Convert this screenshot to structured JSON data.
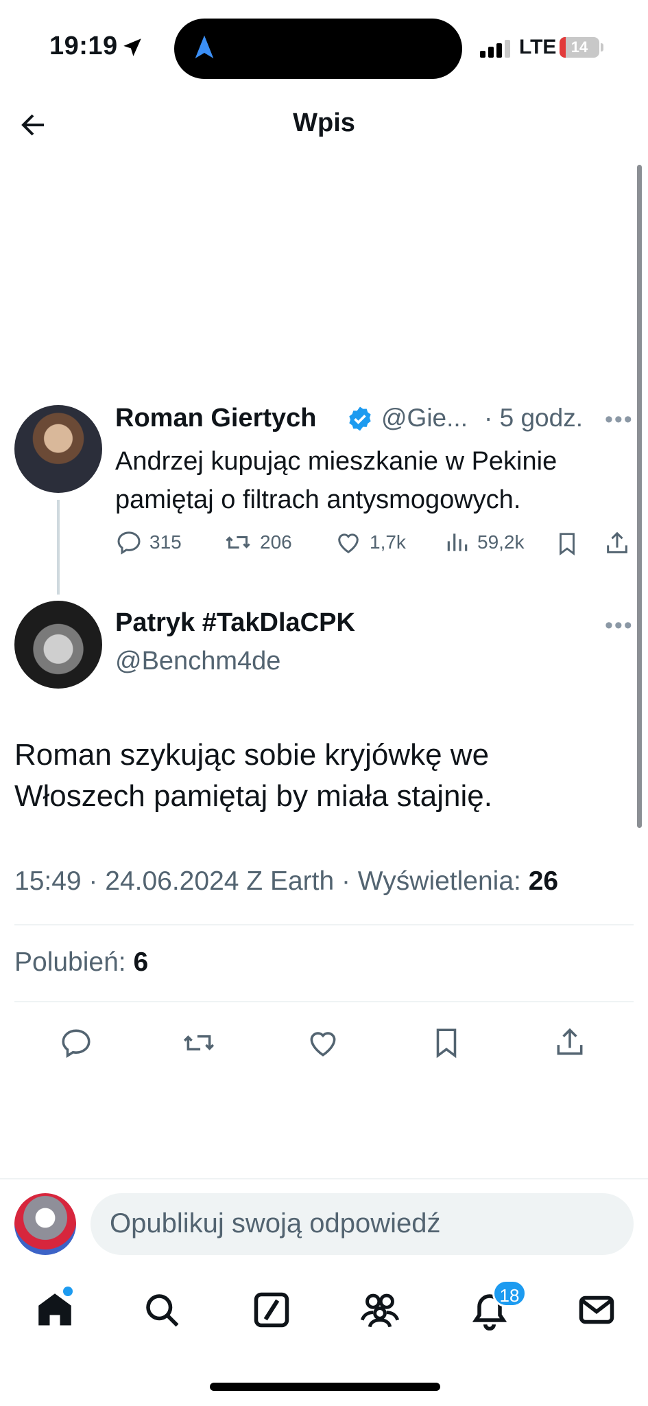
{
  "status_bar": {
    "time": "19:19",
    "network": "LTE",
    "battery": "14"
  },
  "header": {
    "title": "Wpis"
  },
  "parent_tweet": {
    "name": "Roman Giertych",
    "handle": "@Gie...",
    "time": "· 5 godz.",
    "text": "Andrzej kupując mieszkanie w Pekinie pamiętaj o filtrach antysmogowych.",
    "replies": "315",
    "reposts": "206",
    "likes": "1,7k",
    "views": "59,2k"
  },
  "main_tweet": {
    "name": "Patryk #TakDlaCPK",
    "handle": "@Benchm4de",
    "text": "Roman szykując sobie kryjówkę we Włoszech pamiętaj by miała stajnię.",
    "meta": "15:49 · 24.06.2024 Z Earth · Wyświetlenia:",
    "views": "26",
    "likes_label": "Polubień:",
    "likes": "6"
  },
  "reply_bar": {
    "placeholder": "Opublikuj swoją odpowiedź"
  },
  "tab_bar": {
    "notifications_badge": "18"
  },
  "colors": {
    "accent": "#1d9bf0",
    "muted": "#536471",
    "text": "#0f1419",
    "divider": "#eff3f4"
  }
}
